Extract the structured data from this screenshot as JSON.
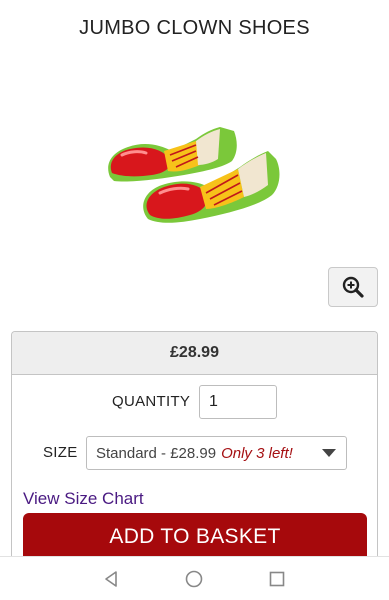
{
  "product": {
    "title": "JUMBO CLOWN SHOES",
    "image_alt": "Clown shoes"
  },
  "zoom": {
    "icon": "zoom-in-icon"
  },
  "purchase": {
    "price": "£28.99",
    "quantity_label": "QUANTITY",
    "quantity_value": "1",
    "size_label": "SIZE",
    "size_selected": "Standard - £28.99",
    "size_stock_note": "Only 3 left!",
    "size_chart_link": "View Size Chart",
    "add_to_basket_label": "ADD TO BASKET"
  },
  "navbar": {
    "items": [
      {
        "icon": "back-icon"
      },
      {
        "icon": "home-icon"
      },
      {
        "icon": "recents-icon"
      }
    ]
  },
  "colors": {
    "accent": "#a6090c",
    "link": "#4a1a82",
    "stock_note": "#a50f12"
  }
}
